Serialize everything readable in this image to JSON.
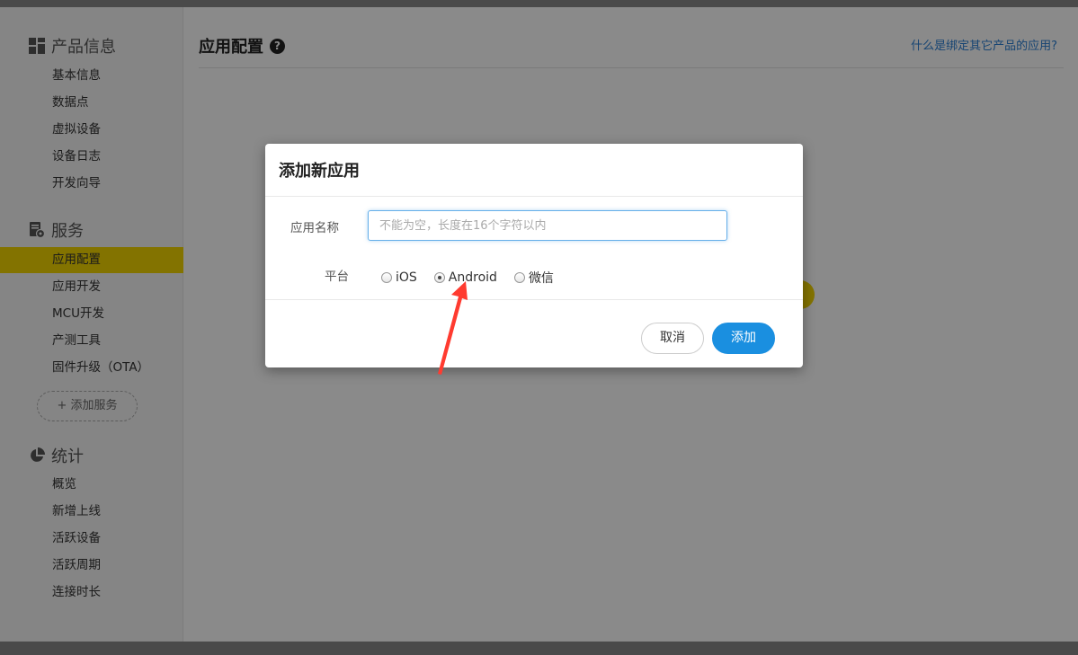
{
  "sidebar": {
    "sections": [
      {
        "title": "产品信息",
        "icon": "grid-icon",
        "items": [
          "基本信息",
          "数据点",
          "虚拟设备",
          "设备日志",
          "开发向导"
        ]
      },
      {
        "title": "服务",
        "icon": "service-doc-icon",
        "items": [
          "应用配置",
          "应用开发",
          "MCU开发",
          "产测工具",
          "固件升级（OTA）"
        ]
      },
      {
        "title": "统计",
        "icon": "pie-chart-icon",
        "items": [
          "概览",
          "新增上线",
          "活跃设备",
          "活跃周期",
          "连接时长"
        ]
      }
    ],
    "active_item": "应用配置",
    "add_service_label": "+ 添加服务"
  },
  "main": {
    "title": "应用配置",
    "help_icon_glyph": "?",
    "help_link": "什么是绑定其它产品的应用?"
  },
  "modal": {
    "title": "添加新应用",
    "name_label": "应用名称",
    "name_placeholder": "不能为空，长度在16个字符以内",
    "name_value": "",
    "platform_label": "平台",
    "platforms": [
      {
        "label": "iOS",
        "checked": false
      },
      {
        "label": "Android",
        "checked": true
      },
      {
        "label": "微信",
        "checked": false
      }
    ],
    "cancel_label": "取消",
    "add_label": "添加"
  },
  "colors": {
    "accent_yellow": "#f2d500",
    "primary_blue": "#1a8fe0",
    "link_blue": "#2a7fd4",
    "annotation_red": "#ff3b30"
  }
}
